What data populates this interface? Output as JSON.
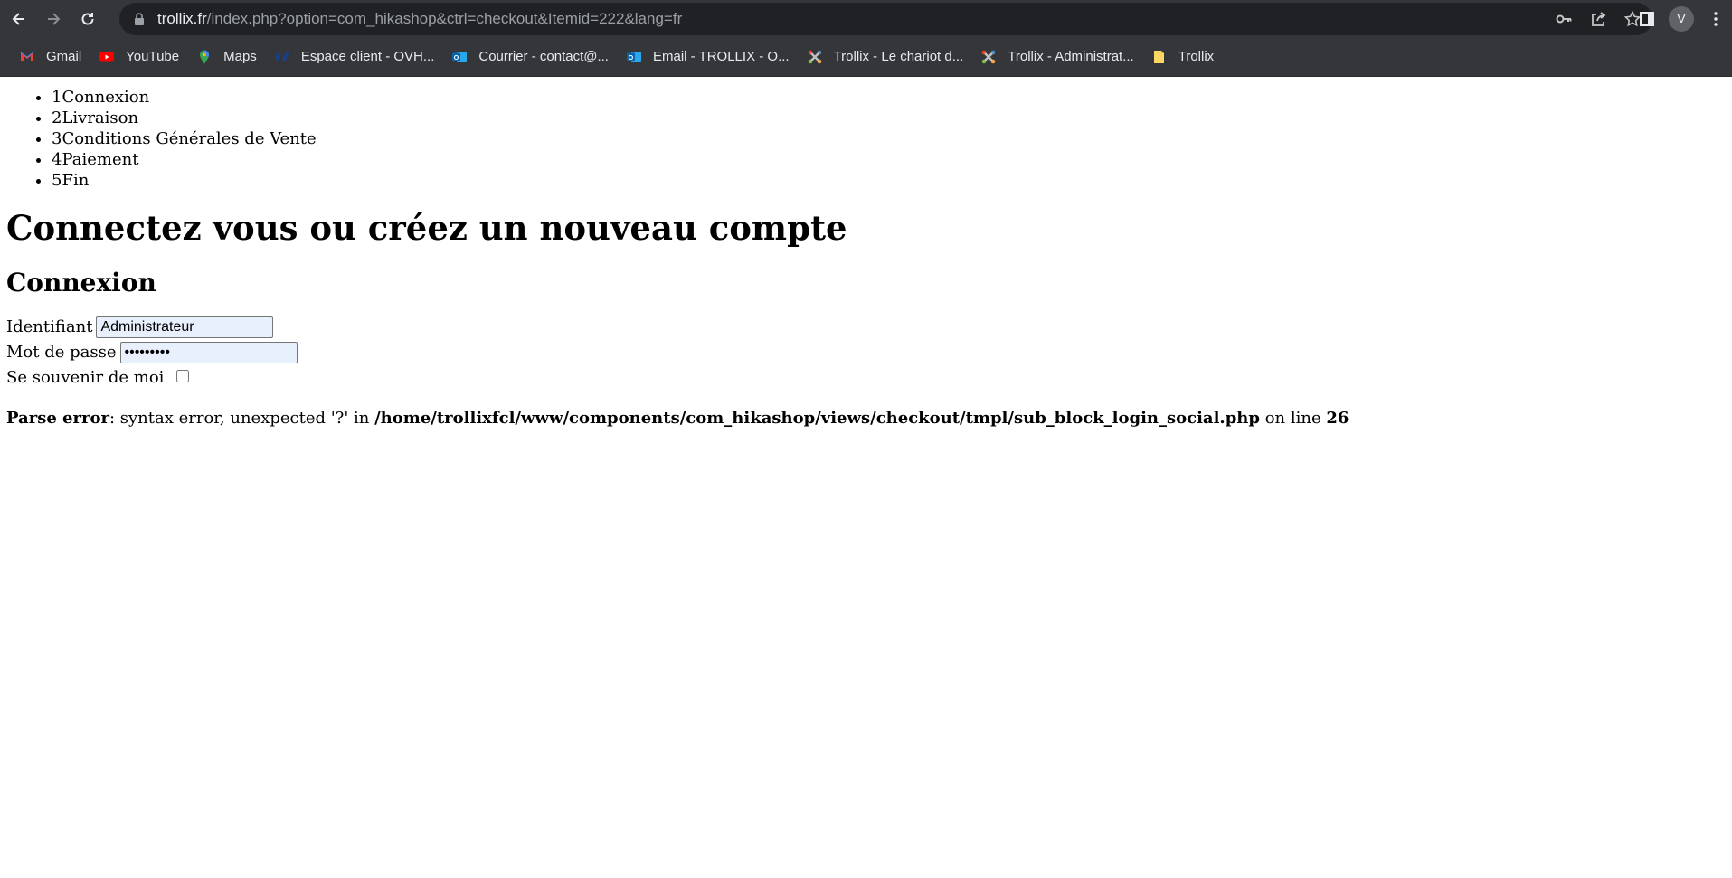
{
  "browser": {
    "url_host": "trollix.fr",
    "url_path": "/index.php?option=com_hikashop&ctrl=checkout&Itemid=222&lang=fr",
    "profile_initial": "V"
  },
  "bookmarks": [
    {
      "label": "Gmail",
      "icon": "gmail-icon"
    },
    {
      "label": "YouTube",
      "icon": "youtube-icon"
    },
    {
      "label": "Maps",
      "icon": "maps-icon"
    },
    {
      "label": "Espace client - OVH...",
      "icon": "ovh-icon"
    },
    {
      "label": "Courrier - contact@...",
      "icon": "outlook-icon"
    },
    {
      "label": "Email - TROLLIX - O...",
      "icon": "outlook-icon"
    },
    {
      "label": "Trollix - Le chariot d...",
      "icon": "joomla-icon"
    },
    {
      "label": "Trollix - Administrat...",
      "icon": "joomla-icon"
    },
    {
      "label": "Trollix",
      "icon": "folder-icon"
    }
  ],
  "steps": [
    "1Connexion",
    "2Livraison",
    "3Conditions Générales de Vente",
    "4Paiement",
    "5Fin"
  ],
  "heading": "Connectez vous ou créez un nouveau compte",
  "subheading": "Connexion",
  "form": {
    "username_label": "Identifiant",
    "username_value": "Administrateur",
    "password_label": "Mot de passe",
    "password_value": "*********",
    "remember_label": "Se souvenir de moi"
  },
  "error": {
    "label": "Parse error",
    "message": ": syntax error, unexpected '?' in ",
    "path": "/home/trollixfcl/www/components/com_hikashop/views/checkout/tmpl/sub_block_login_social.php",
    "on_line": " on line ",
    "line": "26"
  },
  "colors": {
    "chrome_bg": "#35363a",
    "omnibox_bg": "#202124",
    "autofill_bg": "#e8f0fe"
  }
}
